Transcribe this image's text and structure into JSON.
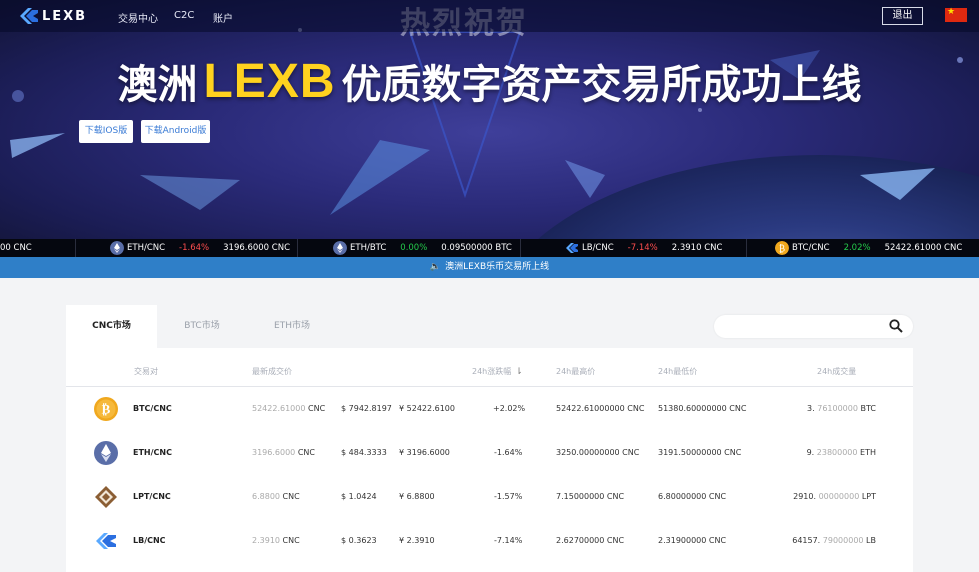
{
  "nav": {
    "logo_text": "LEXB",
    "links": [
      "交易中心",
      "C2C",
      "账户"
    ],
    "logout": "退出"
  },
  "hero": {
    "faint_banner": "热烈祝贺",
    "headline_prefix": "澳洲",
    "headline_brand": "LEXB",
    "headline_suffix": "优质数字资产交易所成功上线",
    "download_ios": "下载IOS版",
    "download_android": "下载Android版"
  },
  "ticker": [
    {
      "price": "00 CNC"
    },
    {
      "pair": "ETH/CNC",
      "change": "-1.64%",
      "price": "3196.6000 CNC",
      "dir": "down"
    },
    {
      "pair": "ETH/BTC",
      "change": "0.00%",
      "price": "0.09500000 BTC",
      "dir": "up"
    },
    {
      "pair": "LB/CNC",
      "change": "-7.14%",
      "price": "2.3910 CNC",
      "dir": "down"
    },
    {
      "pair": "BTC/CNC",
      "change": "2.02%",
      "price": "52422.61000 CNC",
      "dir": "up"
    }
  ],
  "notice": "澳洲LEXB乐币交易所上线",
  "market": {
    "tabs": [
      "CNC市场",
      "BTC市场",
      "ETH市场"
    ],
    "active_tab": 0,
    "search_placeholder": "",
    "columns": [
      "交易对",
      "最新成交价",
      "24h涨跌幅",
      "24h最高价",
      "24h最低价",
      "24h成交量"
    ],
    "rows": [
      {
        "pair": "BTC/CNC",
        "last": "52422.61000",
        "last_unit": "CNC",
        "usd": "$ 7942.8197",
        "cny": "¥ 52422.6100",
        "change": "+2.02%",
        "dir": "up",
        "high": "52422.61000000 CNC",
        "low": "51380.60000000 CNC",
        "vol_int": "3.",
        "vol_dec": "76100000",
        "vol_unit": "BTC"
      },
      {
        "pair": "ETH/CNC",
        "last": "3196.6000",
        "last_unit": "CNC",
        "usd": "$ 484.3333",
        "cny": "¥ 3196.6000",
        "change": "-1.64%",
        "dir": "down",
        "high": "3250.00000000 CNC",
        "low": "3191.50000000 CNC",
        "vol_int": "9.",
        "vol_dec": "23800000",
        "vol_unit": "ETH"
      },
      {
        "pair": "LPT/CNC",
        "last": "6.8800",
        "last_unit": "CNC",
        "usd": "$ 1.0424",
        "cny": "¥ 6.8800",
        "change": "-1.57%",
        "dir": "down",
        "high": "7.15000000 CNC",
        "low": "6.80000000 CNC",
        "vol_int": "2910.",
        "vol_dec": "00000000",
        "vol_unit": "LPT"
      },
      {
        "pair": "LB/CNC",
        "last": "2.3910",
        "last_unit": "CNC",
        "usd": "$ 0.3623",
        "cny": "¥ 2.3910",
        "change": "-7.14%",
        "dir": "down",
        "high": "2.62700000 CNC",
        "low": "2.31900000 CNC",
        "vol_int": "64157.",
        "vol_dec": "79000000",
        "vol_unit": "LB"
      }
    ]
  },
  "colors": {
    "up": "#24c94a",
    "down": "#ff4e4e",
    "accent": "#2f7fc8",
    "brand_yellow": "#ffd21f"
  }
}
